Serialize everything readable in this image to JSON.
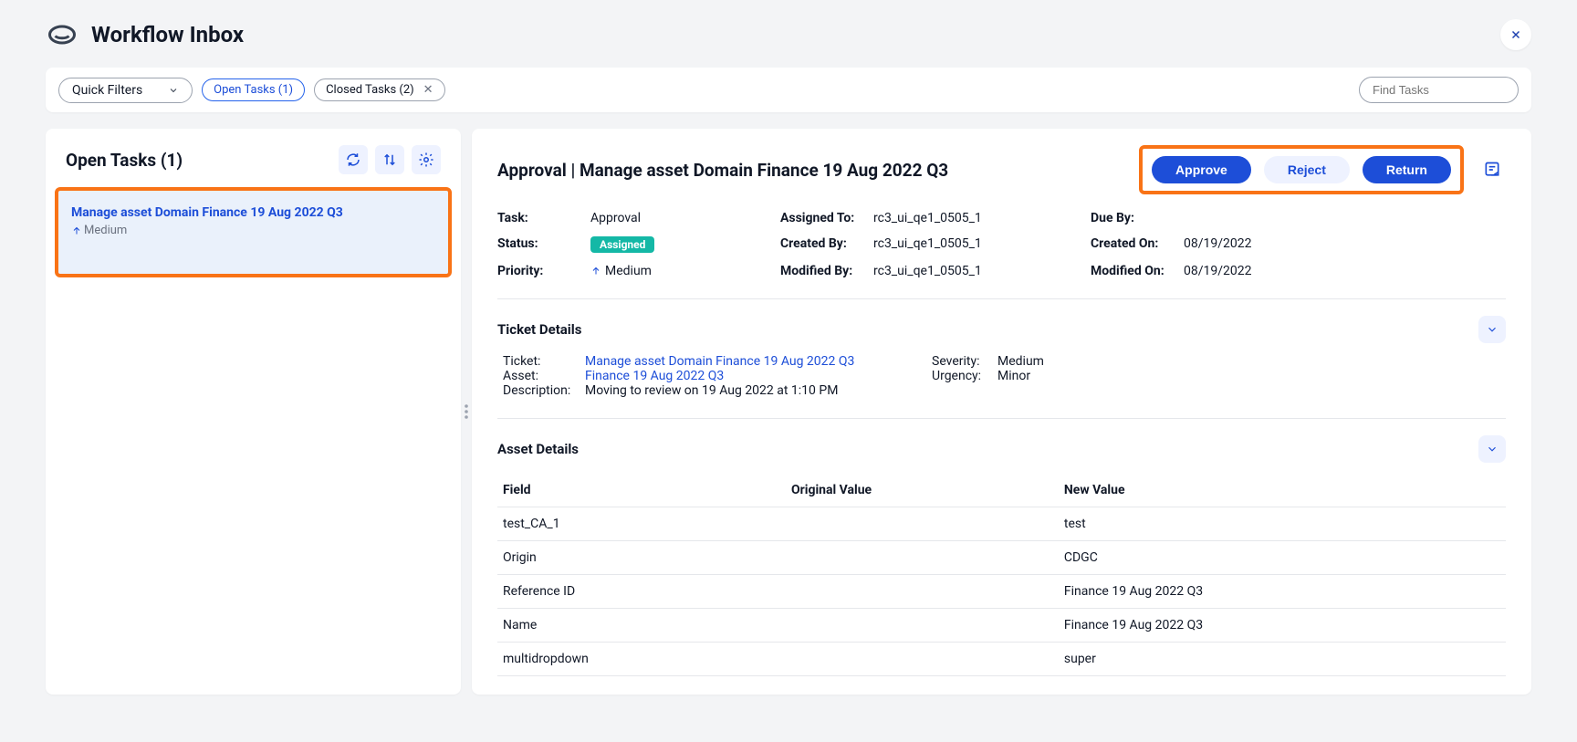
{
  "header": {
    "title": "Workflow Inbox"
  },
  "filters": {
    "dropdown_label": "Quick Filters",
    "chips": [
      {
        "label": "Open Tasks (1)",
        "active": true,
        "closable": false
      },
      {
        "label": "Closed Tasks (2)",
        "active": false,
        "closable": true
      }
    ],
    "search_placeholder": "Find Tasks"
  },
  "left": {
    "title": "Open Tasks (1)",
    "task": {
      "title": "Manage asset Domain Finance 19 Aug 2022 Q3",
      "priority": "Medium"
    }
  },
  "right": {
    "title": "Approval | Manage asset Domain Finance 19 Aug 2022 Q3",
    "actions": {
      "approve": "Approve",
      "reject": "Reject",
      "return": "Return"
    },
    "meta": {
      "task_label": "Task:",
      "task_value": "Approval",
      "status_label": "Status:",
      "status_value": "Assigned",
      "priority_label": "Priority:",
      "priority_value": "Medium",
      "assigned_label": "Assigned To:",
      "assigned_value": "rc3_ui_qe1_0505_1",
      "createdby_label": "Created By:",
      "createdby_value": "rc3_ui_qe1_0505_1",
      "modifiedby_label": "Modified By:",
      "modifiedby_value": "rc3_ui_qe1_0505_1",
      "dueby_label": "Due By:",
      "dueby_value": "",
      "createdon_label": "Created On:",
      "createdon_value": "08/19/2022",
      "modifiedon_label": "Modified On:",
      "modifiedon_value": "08/19/2022"
    },
    "ticket_section": {
      "title": "Ticket Details",
      "ticket_label": "Ticket:",
      "ticket_value": "Manage asset Domain Finance 19 Aug 2022 Q3",
      "asset_label": "Asset:",
      "asset_value": "Finance 19 Aug 2022 Q3",
      "description_label": "Description:",
      "description_value": "Moving to review on 19 Aug 2022 at 1:10 PM",
      "severity_label": "Severity:",
      "severity_value": "Medium",
      "urgency_label": "Urgency:",
      "urgency_value": "Minor"
    },
    "asset_section": {
      "title": "Asset Details",
      "columns": {
        "field": "Field",
        "original": "Original Value",
        "new": "New Value"
      },
      "rows": [
        {
          "field": "test_CA_1",
          "original": "",
          "new": "test"
        },
        {
          "field": "Origin",
          "original": "",
          "new": "CDGC"
        },
        {
          "field": "Reference ID",
          "original": "",
          "new": "Finance 19 Aug 2022 Q3"
        },
        {
          "field": "Name",
          "original": "",
          "new": "Finance 19 Aug 2022 Q3"
        },
        {
          "field": "multidropdown",
          "original": "",
          "new": "super"
        }
      ]
    }
  }
}
